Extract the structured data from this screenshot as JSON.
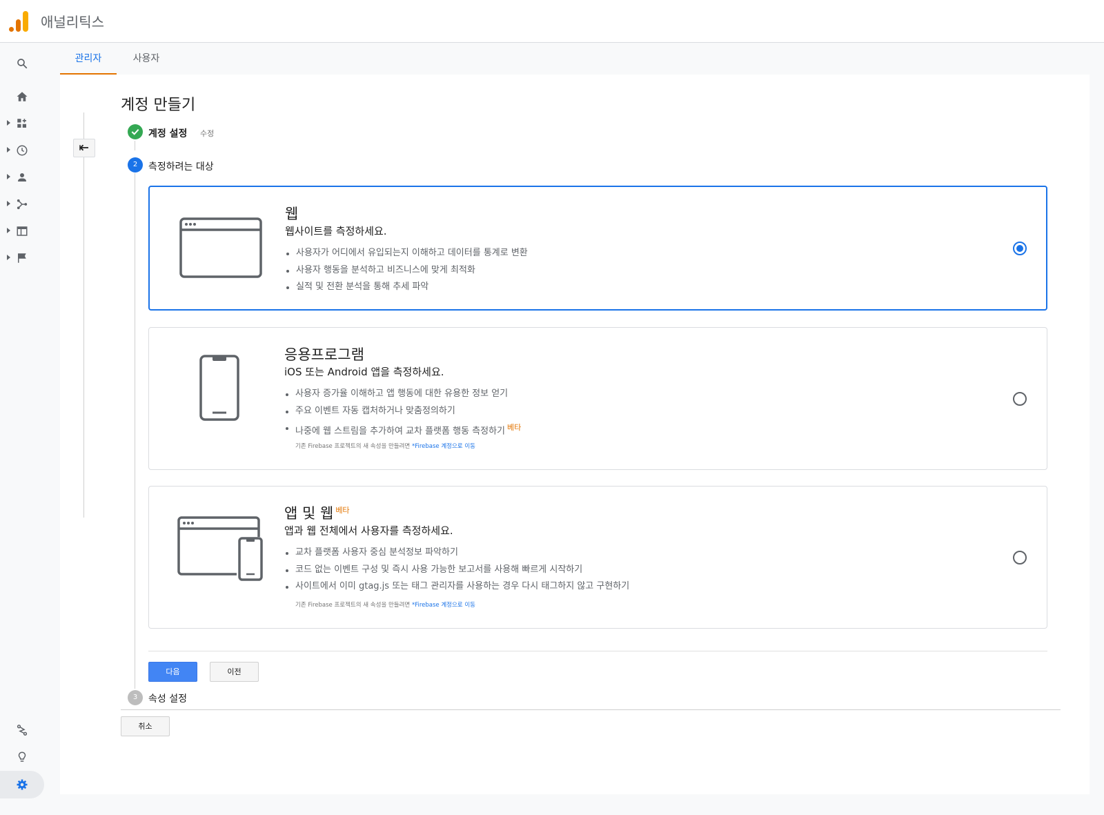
{
  "app": {
    "title": "애널리틱스"
  },
  "tabs": [
    {
      "label": "관리자"
    },
    {
      "label": "사용자"
    }
  ],
  "page": {
    "title": "계정 만들기"
  },
  "steps": [
    {
      "number": "1",
      "label": "계정 설정",
      "action": "수정",
      "state": "done"
    },
    {
      "number": "2",
      "label": "측정하려는 대상",
      "state": "current"
    },
    {
      "number": "3",
      "label": "속성 설정",
      "state": "pending"
    }
  ],
  "options": [
    {
      "title": "웹",
      "subtitle": "웹사이트를 측정하세요.",
      "bullets": [
        "사용자가 어디에서 유입되는지 이해하고 데이터를 통계로 변환",
        "사용자 행동을 분석하고 비즈니스에 맞게 최적화",
        "실적 및 전환 분석을 통해 추세 파악"
      ],
      "selected": true,
      "icon": "browser-window-icon"
    },
    {
      "title": "응용프로그램",
      "subtitle": "iOS 또는 Android 앱을 측정하세요.",
      "bullets": [
        "사용자 증가율 이해하고 앱 행동에 대한 유용한 정보 얻기",
        "주요 이벤트 자동 캡처하거나 맞춤정의하기",
        "나중에 웹 스트림을 추가하여 교차 플랫폼 행동 측정하기"
      ],
      "bullet_badge": "베타",
      "note_text": "기존 Firebase 프로젝트의 새 속성을 만들려면 ",
      "note_link": "*Firebase 계정으로 이동",
      "selected": false,
      "icon": "phone-icon"
    },
    {
      "title": "앱 및 웹",
      "title_badge": "베타",
      "subtitle": "앱과 웹 전체에서 사용자를 측정하세요.",
      "bullets": [
        "교차 플랫폼 사용자 중심 분석정보 파악하기",
        "코드 없는 이벤트 구성 및 즉시 사용 가능한 보고서를 사용해 빠르게 시작하기",
        "사이트에서 이미 gtag.js 또는 태그 관리자를 사용하는 경우 다시 태그하지 않고 구현하기"
      ],
      "note_text": "기존 Firebase 프로젝트의 새 속성을 만들려면 ",
      "note_link": "*Firebase 계정으로 이동",
      "selected": false,
      "icon": "browser-and-phone-icon"
    }
  ],
  "buttons": {
    "next": "다음",
    "prev": "이전",
    "cancel": "취소"
  },
  "nav_icons": [
    "search-icon",
    "home-icon",
    "customization-icon",
    "realtime-icon",
    "audience-icon",
    "acquisition-icon",
    "behavior-icon",
    "conversions-icon",
    "attribution-icon",
    "discover-icon",
    "admin-gear-icon"
  ],
  "colors": {
    "accent": "#1a73e8",
    "brand_orange": "#e37400",
    "success": "#34a853"
  }
}
